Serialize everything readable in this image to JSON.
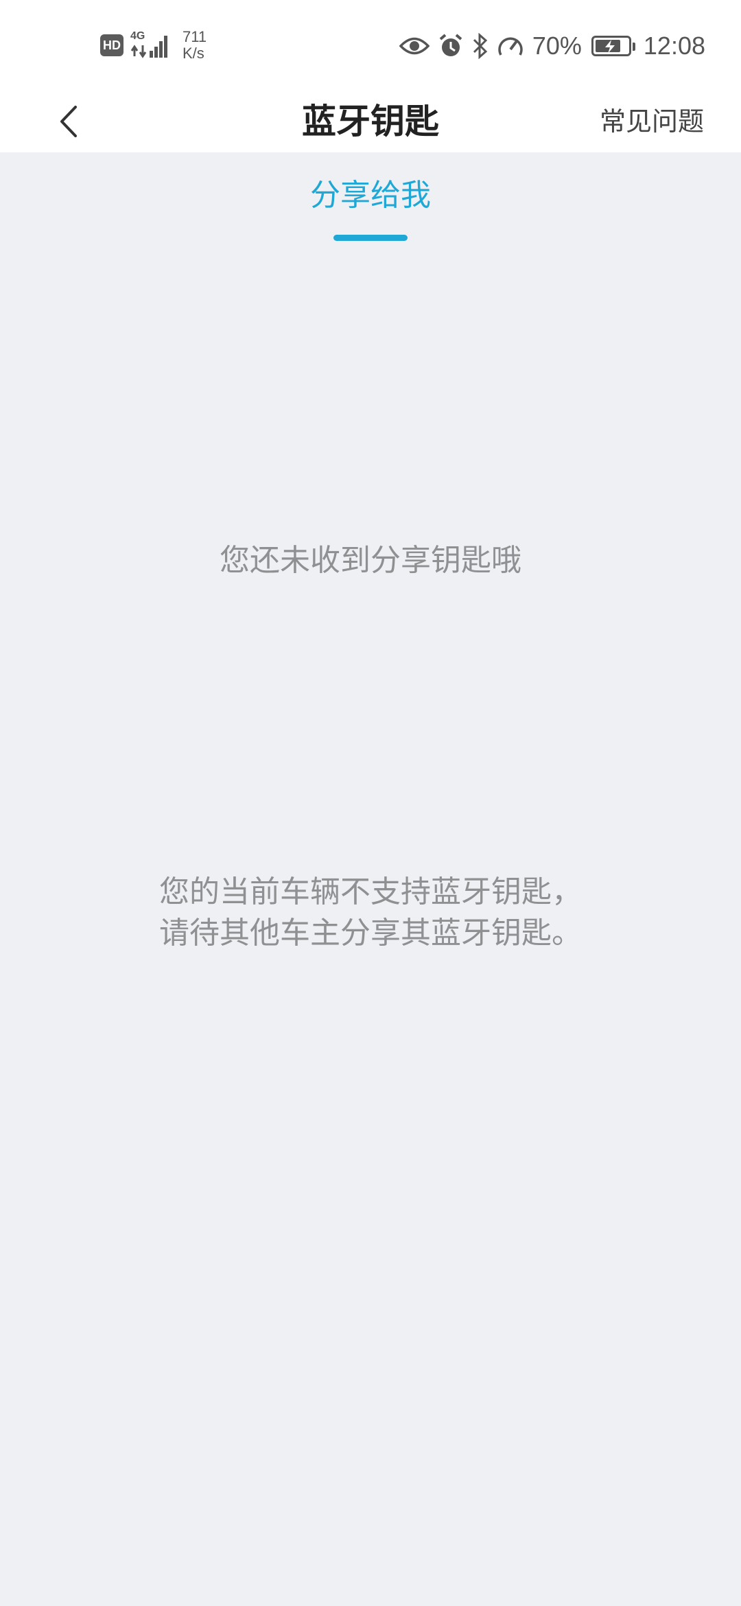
{
  "status_bar": {
    "hd_badge": "HD",
    "network_type": "4G",
    "speed_value": "711",
    "speed_unit": "K/s",
    "battery_percent": "70%",
    "time": "12:08",
    "icons": [
      "eye-icon",
      "alarm-icon",
      "bluetooth-icon",
      "speedometer-icon",
      "battery-charging-icon"
    ]
  },
  "nav": {
    "title": "蓝牙钥匙",
    "faq_label": "常见问题",
    "back_icon": "chevron-left-icon"
  },
  "tabs": [
    {
      "label": "分享给我",
      "active": true
    }
  ],
  "content": {
    "empty_message": "您还未收到分享钥匙哦",
    "unsupported_line1": "您的当前车辆不支持蓝牙钥匙，",
    "unsupported_line2": "请待其他车主分享其蓝牙钥匙。"
  },
  "colors": {
    "accent": "#1fa8d6",
    "background": "#eff0f3",
    "header": "#ffffff",
    "muted_text": "#8f9092"
  }
}
